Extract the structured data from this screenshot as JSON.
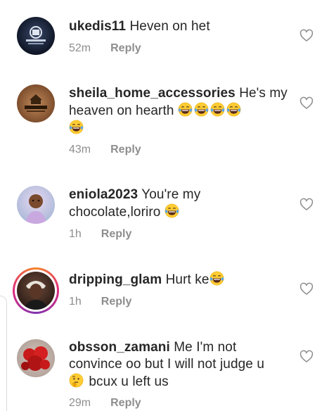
{
  "comments": [
    {
      "username": "ukedis11",
      "text": "Heven on het",
      "time": "52m",
      "reply": "Reply",
      "avatar_icon": "avatar-dark-logo",
      "emojis_line1": 0,
      "emojis_line2": 0
    },
    {
      "username": "sheila_home_accessories",
      "text": "He's my heaven on hearth",
      "time": "43m",
      "reply": "Reply",
      "avatar_icon": "avatar-sheila-logo",
      "emojis_line1": 4,
      "emojis_line2": 1
    },
    {
      "username": "eniola2023",
      "text": "You're my chocolate,loriro",
      "time": "1h",
      "reply": "Reply",
      "avatar_icon": "avatar-child-photo",
      "emojis_line1": 1,
      "emojis_line2": 0
    },
    {
      "username": "dripping_glam",
      "text": "Hurt ke",
      "time": "1h",
      "reply": "Reply",
      "avatar_icon": "avatar-woman-photo-story",
      "emojis_line1": 1,
      "emojis_line2": 0
    },
    {
      "username": "obsson_zamani",
      "text_line1": "Me I'm not convince oo but I will not judge u",
      "text_line2": "bcux u left us",
      "time": "29m",
      "reply": "Reply",
      "avatar_icon": "avatar-red-flowers-photo",
      "emojis": 1
    }
  ],
  "icons": {
    "like": "heart-outline-icon",
    "laugh": "tears-of-joy-emoji",
    "thinking": "thinking-face-emoji"
  },
  "colors": {
    "text": "#262626",
    "muted": "#8e8e8e",
    "story_ring": "#dd2a7b"
  }
}
